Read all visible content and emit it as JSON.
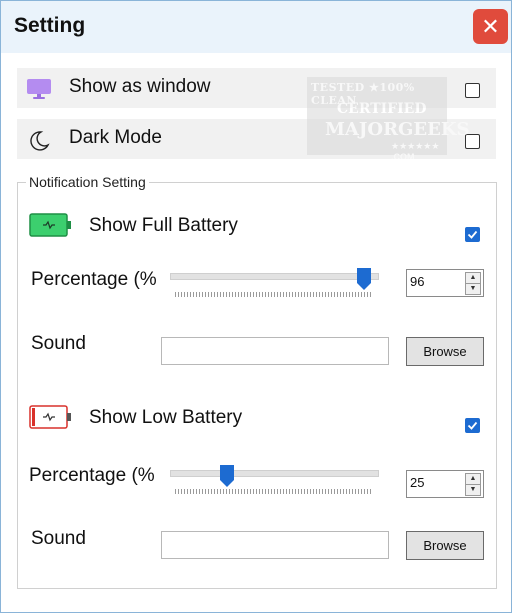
{
  "window": {
    "title": "Setting",
    "close_label": "✕"
  },
  "options": {
    "show_as_window": {
      "label": "Show as window",
      "checked": false,
      "icon": "monitor-icon"
    },
    "dark_mode": {
      "label": "Dark Mode",
      "checked": false,
      "icon": "moon-icon"
    }
  },
  "watermark": {
    "line1": "TESTED ★100% CLEAN",
    "line2": "CERTIFIED",
    "line3": "MAJORGEEKS",
    "line4": "★★★★★★ .COM"
  },
  "notification": {
    "group_label": "Notification Setting",
    "full": {
      "label": "Show Full Battery",
      "checked": true,
      "percentage_label": "Percentage (%",
      "percentage_value": "96",
      "slider_fraction": 0.96,
      "sound_label": "Sound",
      "sound_value": "",
      "browse_label": "Browse",
      "icon": "battery-full-icon",
      "color": "#3ccf6e"
    },
    "low": {
      "label": "Show Low Battery",
      "checked": true,
      "percentage_label": "Percentage (%",
      "percentage_value": "25",
      "slider_fraction": 0.25,
      "sound_label": "Sound",
      "sound_value": "",
      "browse_label": "Browse",
      "icon": "battery-low-icon",
      "color": "#d9312b"
    }
  },
  "colors": {
    "accent": "#1d6bd1",
    "close": "#e04b3c",
    "titlebar": "#eaf3fb"
  }
}
